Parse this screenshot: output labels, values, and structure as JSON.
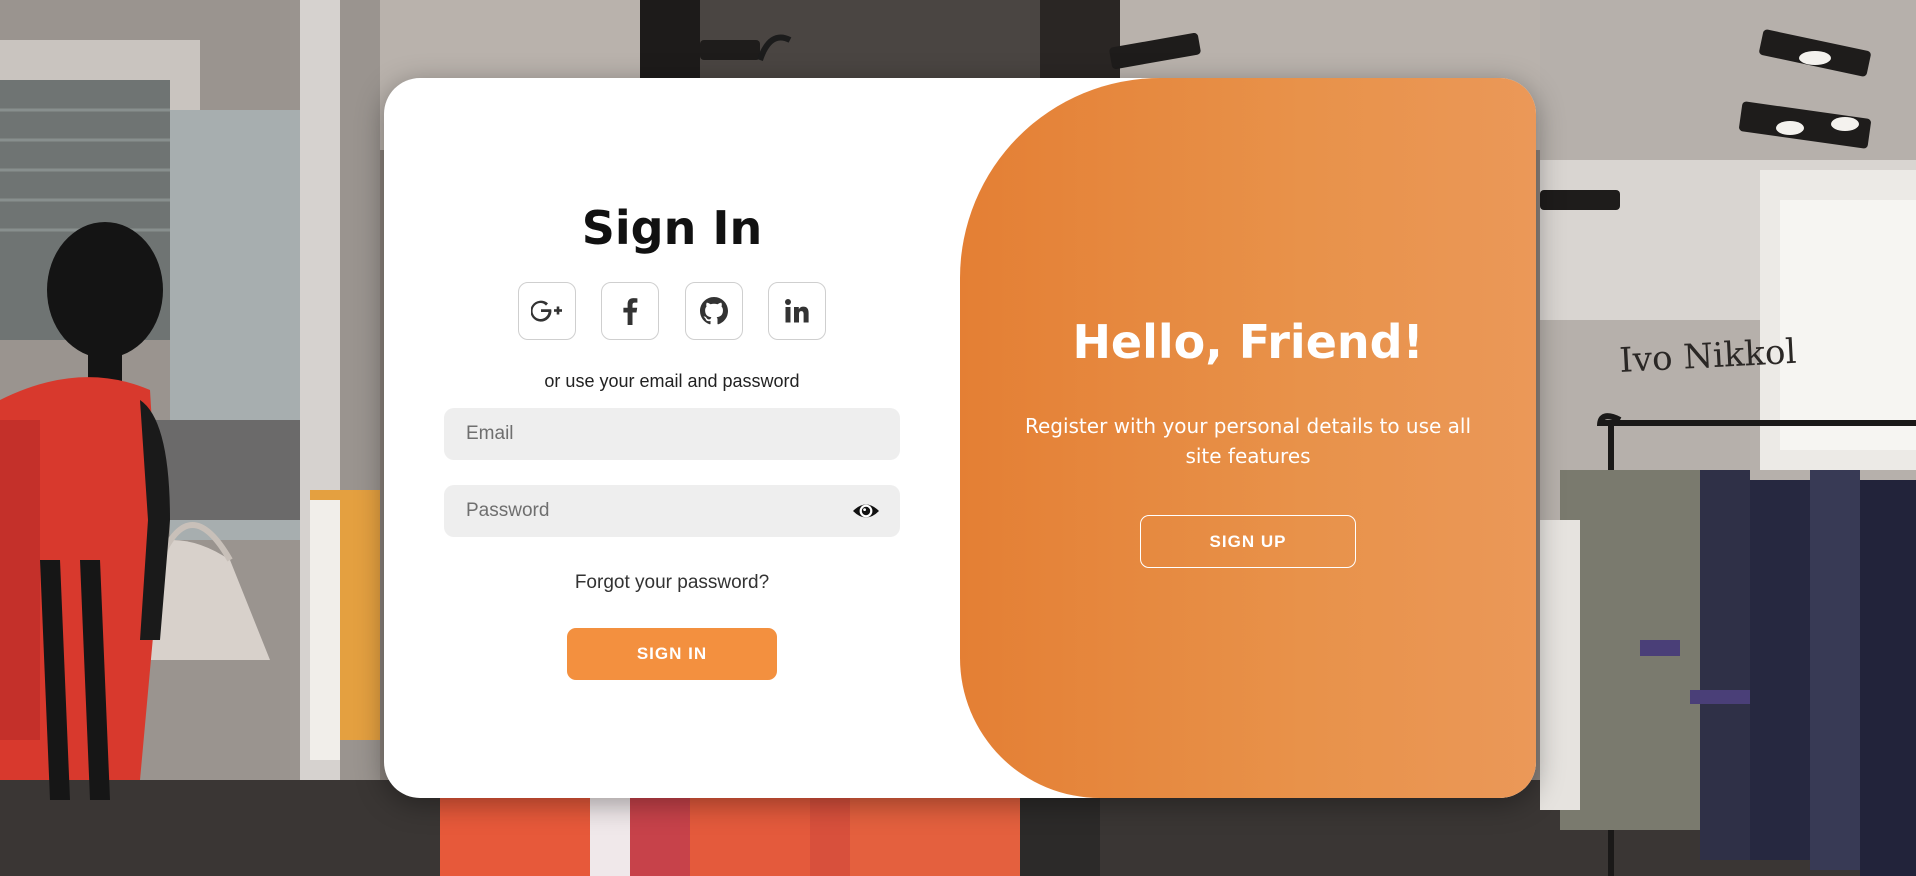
{
  "signin": {
    "title": "Sign In",
    "social_buttons": [
      {
        "name": "google-plus",
        "label": "G+"
      },
      {
        "name": "facebook",
        "label": "f"
      },
      {
        "name": "github",
        "label": "github"
      },
      {
        "name": "linkedin",
        "label": "in"
      }
    ],
    "hint": "or use your email and password",
    "email_placeholder": "Email",
    "email_value": "",
    "password_placeholder": "Password",
    "password_value": "",
    "forgot_label": "Forgot your password?",
    "submit_label": "SIGN IN"
  },
  "panel": {
    "title": "Hello, Friend!",
    "text": "Register with your personal details to use all site features",
    "button_label": "SIGN UP"
  },
  "icons": {
    "google_plus": "google-plus-icon",
    "facebook": "facebook-icon",
    "github": "github-icon",
    "linkedin": "linkedin-icon",
    "eye": "eye-icon"
  },
  "colors": {
    "accent": "#f3903f",
    "panel_start": "#e47f34",
    "panel_end": "#eb9858",
    "field_bg": "#eeeeee"
  }
}
